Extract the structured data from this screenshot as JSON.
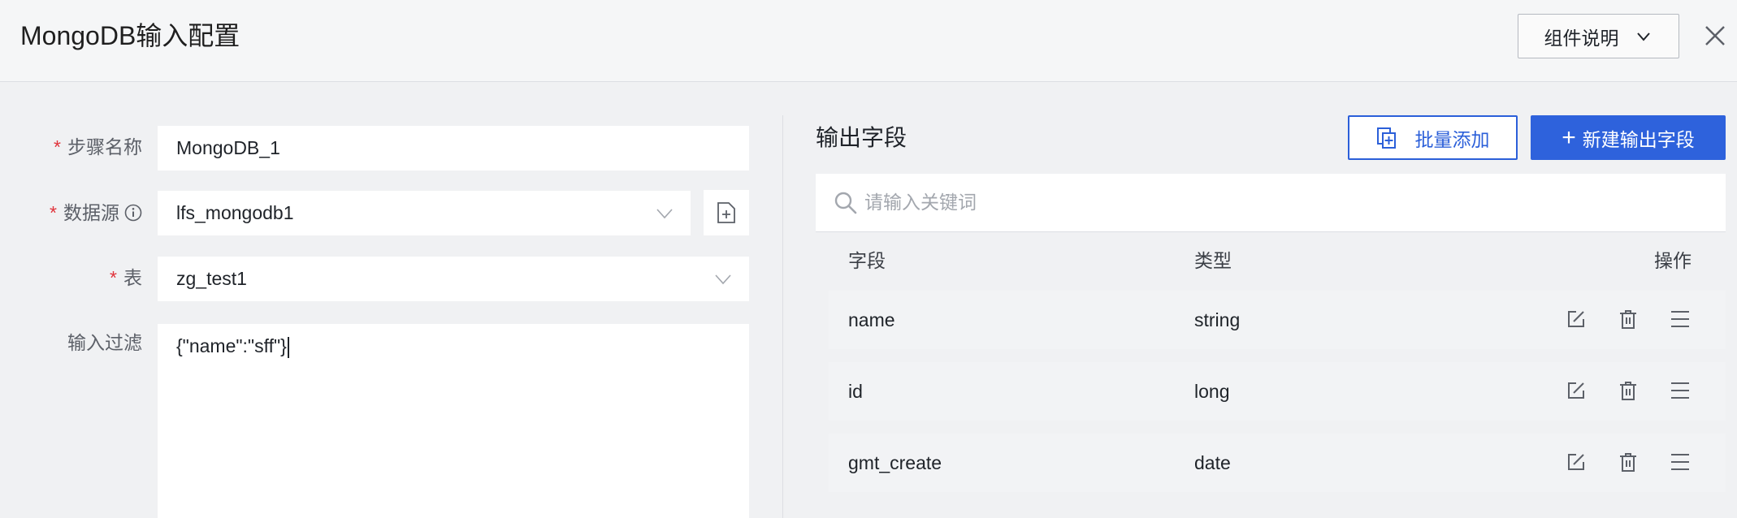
{
  "header": {
    "title": "MongoDB输入配置",
    "guide_label": "组件说明"
  },
  "form": {
    "step_name": {
      "label": "步骤名称",
      "required": "*",
      "value": "MongoDB_1"
    },
    "datasource": {
      "label": "数据源",
      "required": "*",
      "value": "lfs_mongodb1"
    },
    "table": {
      "label": "表",
      "required": "*",
      "value": "zg_test1"
    },
    "filter": {
      "label": "输入过滤",
      "value": "{\"name\":\"sff\"}"
    }
  },
  "output": {
    "title": "输出字段",
    "batch_add_label": "批量添加",
    "new_field_label": "新建输出字段",
    "search_placeholder": "请输入关键词",
    "columns": {
      "field": "字段",
      "type": "类型",
      "action": "操作"
    },
    "rows": [
      {
        "field": "name",
        "type": "string"
      },
      {
        "field": "id",
        "type": "long"
      },
      {
        "field": "gmt_create",
        "type": "date"
      }
    ]
  },
  "colors": {
    "primary": "#2e62dc",
    "required": "#e0333b",
    "background": "#f0f1f3"
  },
  "icons": [
    "chevron-down-icon",
    "close-icon",
    "info-icon",
    "add-file-icon",
    "copy-add-icon",
    "plus-icon",
    "search-icon",
    "edit-icon",
    "delete-icon",
    "drag-handle-icon"
  ]
}
